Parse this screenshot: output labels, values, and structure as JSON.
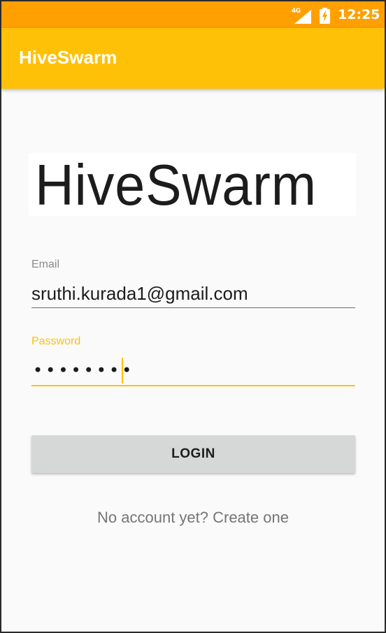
{
  "status_bar": {
    "network": "4G",
    "time": "12:25",
    "icons": [
      "signal-icon",
      "battery-charging-icon"
    ]
  },
  "app_bar": {
    "title": "HiveSwarm"
  },
  "logo": {
    "text": "HiveSwarm"
  },
  "form": {
    "email_label": "Email",
    "email_value": "sruthi.kurada1@gmail.com",
    "password_label": "Password",
    "password_value": "••••••••"
  },
  "actions": {
    "login_label": "LOGIN",
    "create_account_text": "No account yet? Create one"
  },
  "colors": {
    "status_bar": "#ffa000",
    "app_bar": "#ffc107",
    "accent": "#ffc107",
    "button": "#d6d7d7"
  }
}
